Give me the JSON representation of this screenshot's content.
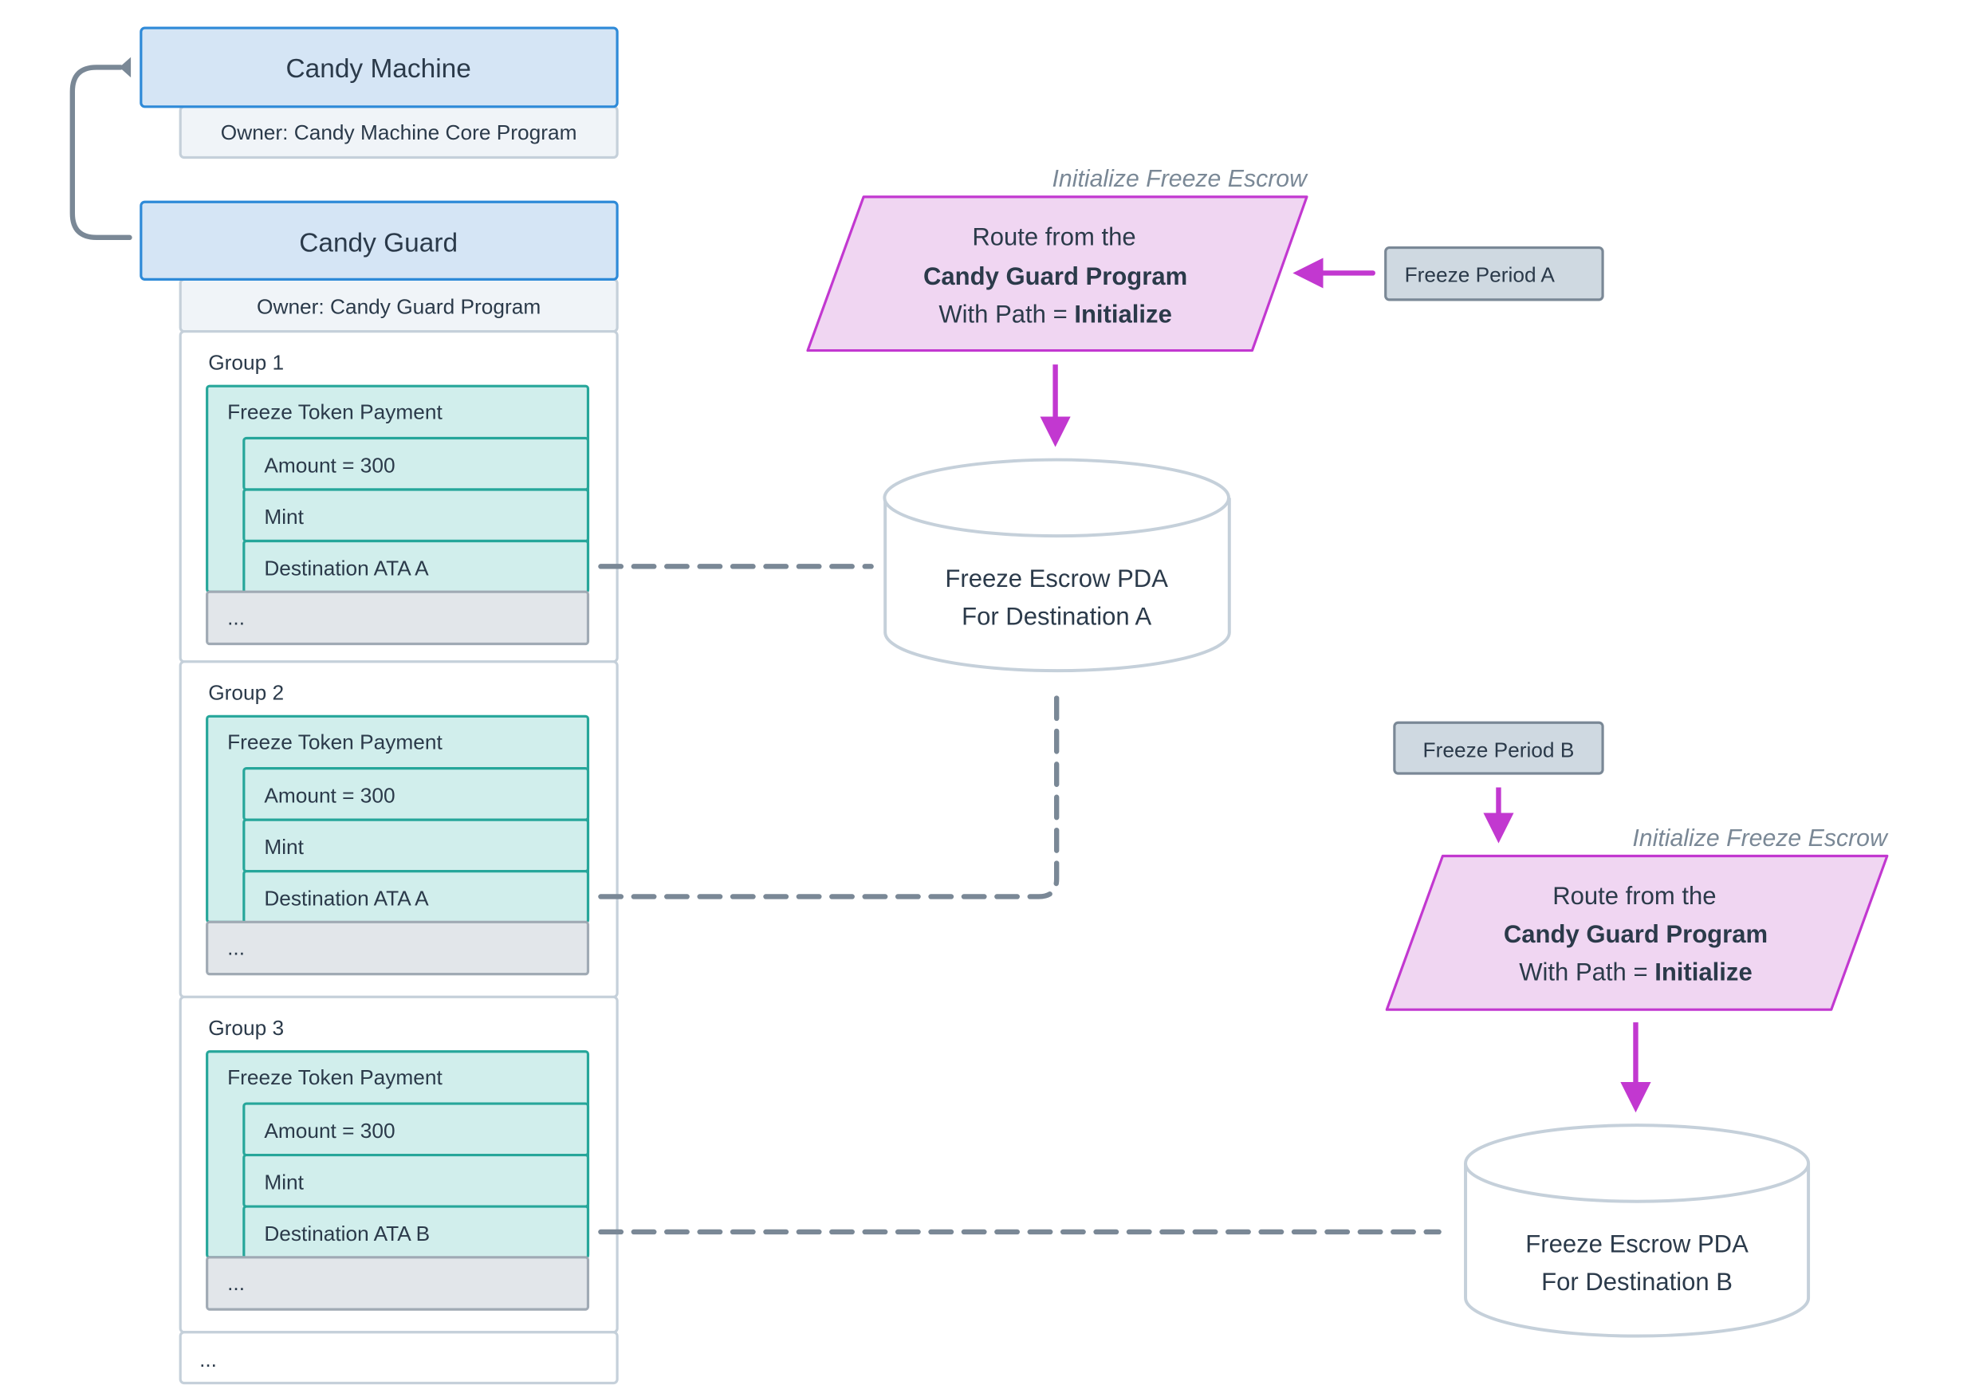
{
  "colors": {
    "account_fill": "#d5e5f5",
    "account_stroke": "#2e8ad8",
    "owner_fill": "#f0f4f8",
    "guard_fill": "#d1eeec",
    "guard_stroke": "#26a69a",
    "route_fill": "#f0d6f2",
    "route_stroke": "#c238d0",
    "connector": "#7a8896"
  },
  "candy_machine": {
    "title": "Candy Machine",
    "owner": "Owner: Candy Machine Core Program"
  },
  "candy_guard": {
    "title": "Candy Guard",
    "owner": "Owner: Candy Guard Program"
  },
  "groups": [
    {
      "label": "Group 1",
      "guard": "Freeze Token Payment",
      "settings": [
        "Amount = 300",
        "Mint",
        "Destination ATA A"
      ],
      "more": "..."
    },
    {
      "label": "Group 2",
      "guard": "Freeze Token Payment",
      "settings": [
        "Amount = 300",
        "Mint",
        "Destination ATA A"
      ],
      "more": "..."
    },
    {
      "label": "Group 3",
      "guard": "Freeze Token Payment",
      "settings": [
        "Amount = 300",
        "Mint",
        "Destination ATA B"
      ],
      "more": "..."
    }
  ],
  "groups_more": "...",
  "routes": [
    {
      "caption": "Initialize Freeze Escrow",
      "line1": "Route from the",
      "line2": "Candy Guard Program",
      "line3_prefix": "With Path = ",
      "line3_bold": "Initialize",
      "input": "Freeze Period A",
      "pda_line1": "Freeze Escrow PDA",
      "pda_line2": "For Destination A"
    },
    {
      "caption": "Initialize Freeze Escrow",
      "line1": "Route from the",
      "line2": "Candy Guard Program",
      "line3_prefix": "With Path = ",
      "line3_bold": "Initialize",
      "input": "Freeze Period B",
      "pda_line1": "Freeze Escrow PDA",
      "pda_line2": "For Destination B"
    }
  ]
}
